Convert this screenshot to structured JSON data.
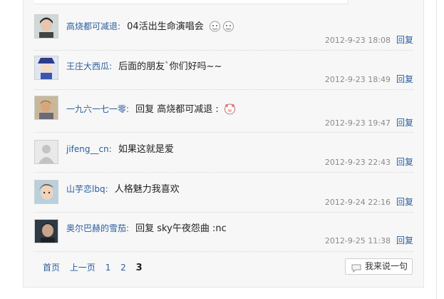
{
  "comments": [
    {
      "user": "高烧都可减退",
      "sep": ":",
      "text": "04活出生命演唱会",
      "emoji": [
        "face-emoji",
        "face-emoji"
      ],
      "time": "2012-9-23 18:08",
      "reply": "回复"
    },
    {
      "user": "王庄大西瓜",
      "sep": ":",
      "text": "后面的朋友`你们好吗~~",
      "emoji": [],
      "time": "2012-9-23 18:49",
      "reply": "回复"
    },
    {
      "user": "一九六一七一零",
      "sep": ":",
      "text": "回复 高烧都可减退 :",
      "emoji": [
        "pig-emoji"
      ],
      "time": "2012-9-23 19:47",
      "reply": "回复"
    },
    {
      "user": "jifeng__cn",
      "sep": ":",
      "text": "如果这就是爱",
      "emoji": [],
      "time": "2012-9-23 22:43",
      "reply": "回复"
    },
    {
      "user": "山芋恋lbq",
      "sep": ":",
      "text": "人格魅力我喜欢",
      "emoji": [],
      "time": "2012-9-24 22:16",
      "reply": "回复"
    },
    {
      "user": "奥尔巴赫的雪茄",
      "sep": ":",
      "text": "回复 sky午夜怨曲 :nc",
      "emoji": [],
      "time": "2012-9-25 11:38",
      "reply": "回复"
    }
  ],
  "pager": {
    "first": "首页",
    "prev": "上一页",
    "p1": "1",
    "p2": "2",
    "p3": "3"
  },
  "say_button": {
    "label": "我来说一句",
    "icon": "speech-bubble-icon"
  }
}
